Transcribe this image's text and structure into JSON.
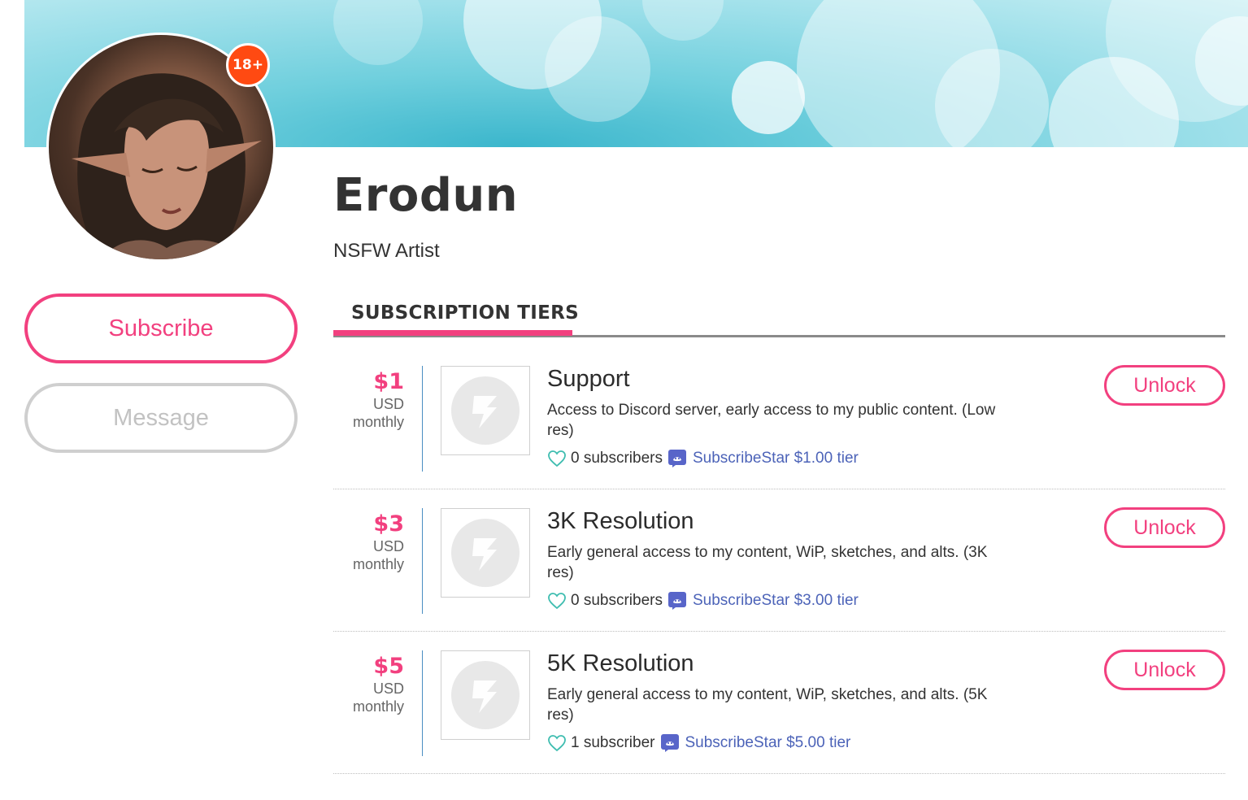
{
  "profile": {
    "name": "Erodun",
    "tagline": "NSFW Artist",
    "age_badge": "18+"
  },
  "actions": {
    "subscribe_label": "Subscribe",
    "message_label": "Message"
  },
  "tiers_section": {
    "title": "SUBSCRIPTION TIERS",
    "tiers": [
      {
        "amount": "$1",
        "currency": "USD",
        "period": "monthly",
        "title": "Support",
        "description": "Access to Discord server, early access to my public content. (Low res)",
        "subscribers": "0 subscribers",
        "discord": "SubscribeStar $1.00 tier",
        "unlock_label": "Unlock"
      },
      {
        "amount": "$3",
        "currency": "USD",
        "period": "monthly",
        "title": "3K Resolution",
        "description": "Early general access to my content, WiP, sketches, and alts. (3K res)",
        "subscribers": "0 subscribers",
        "discord": "SubscribeStar $3.00 tier",
        "unlock_label": "Unlock"
      },
      {
        "amount": "$5",
        "currency": "USD",
        "period": "monthly",
        "title": "5K Resolution",
        "description": "Early general access to my content, WiP, sketches, and alts. (5K res)",
        "subscribers": "1 subscriber",
        "discord": "SubscribeStar $5.00 tier",
        "unlock_label": "Unlock"
      }
    ]
  },
  "colors": {
    "accent": "#f2407f",
    "badge": "#ff4a12",
    "discord_link": "#4c63b8",
    "heart": "#3fbdb0",
    "divider": "#4a8ec2"
  },
  "icons": {
    "heart": "heart-outline-icon",
    "discord": "discord-icon",
    "tier_placeholder": "subscribestar-logo-icon"
  }
}
